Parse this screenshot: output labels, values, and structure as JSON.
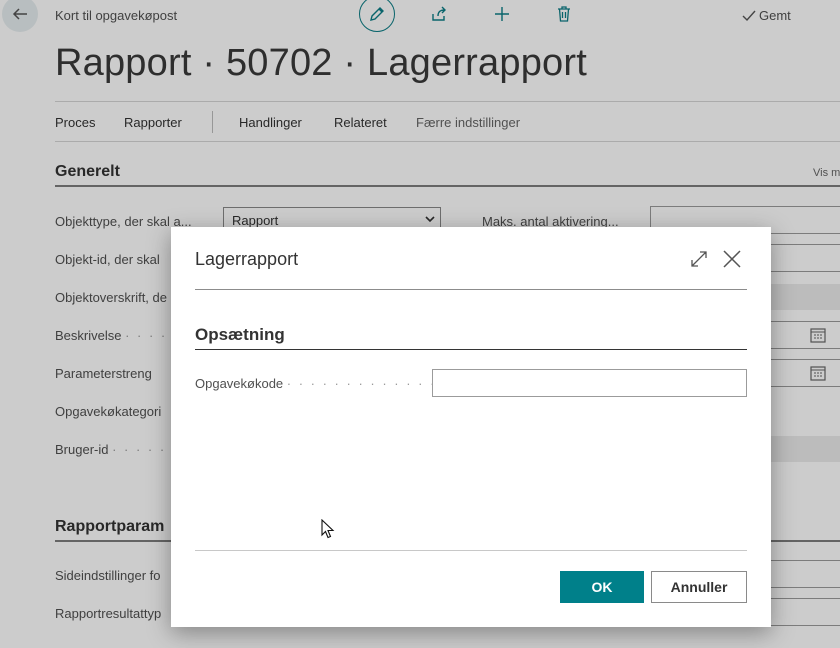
{
  "topbar": {
    "breadcrumb": "Kort til opgavekøpost",
    "saved_label": "Gemt",
    "icons": [
      "back-arrow-icon",
      "edit-pencil-icon",
      "share-icon",
      "plus-icon",
      "delete-icon",
      "checkmark-icon"
    ]
  },
  "page": {
    "title": "Rapport · 50702 · Lagerrapport",
    "actions": [
      "Proces",
      "Rapporter",
      "Handlinger",
      "Relateret",
      "Færre indstillinger"
    ]
  },
  "general": {
    "heading": "Generelt",
    "show_more": "Vis m",
    "fields": [
      {
        "label": "Objekttype, der skal a..."
      },
      {
        "label": "Objekt-id, der skal"
      },
      {
        "label": "Objektoverskrift, de"
      },
      {
        "label": "Beskrivelse"
      },
      {
        "label": "Parameterstreng"
      },
      {
        "label": "Opgavekøkategori"
      },
      {
        "label": "Bruger-id"
      }
    ],
    "object_type_value": "Rapport",
    "max_activations_label": "Maks. antal aktivering..."
  },
  "report_params": {
    "heading": "Rapportparam",
    "fields": [
      {
        "label": "Sideindstillinger fo"
      },
      {
        "label": "Rapportresultattyp"
      }
    ]
  },
  "dialog": {
    "title": "Lagerrapport",
    "section": "Opsætning",
    "field_label": "Opgavekøkode",
    "field_value": "",
    "ok_label": "OK",
    "cancel_label": "Annuller"
  },
  "colors": {
    "accent": "#00808a",
    "accent_border": "#0c7e86"
  }
}
